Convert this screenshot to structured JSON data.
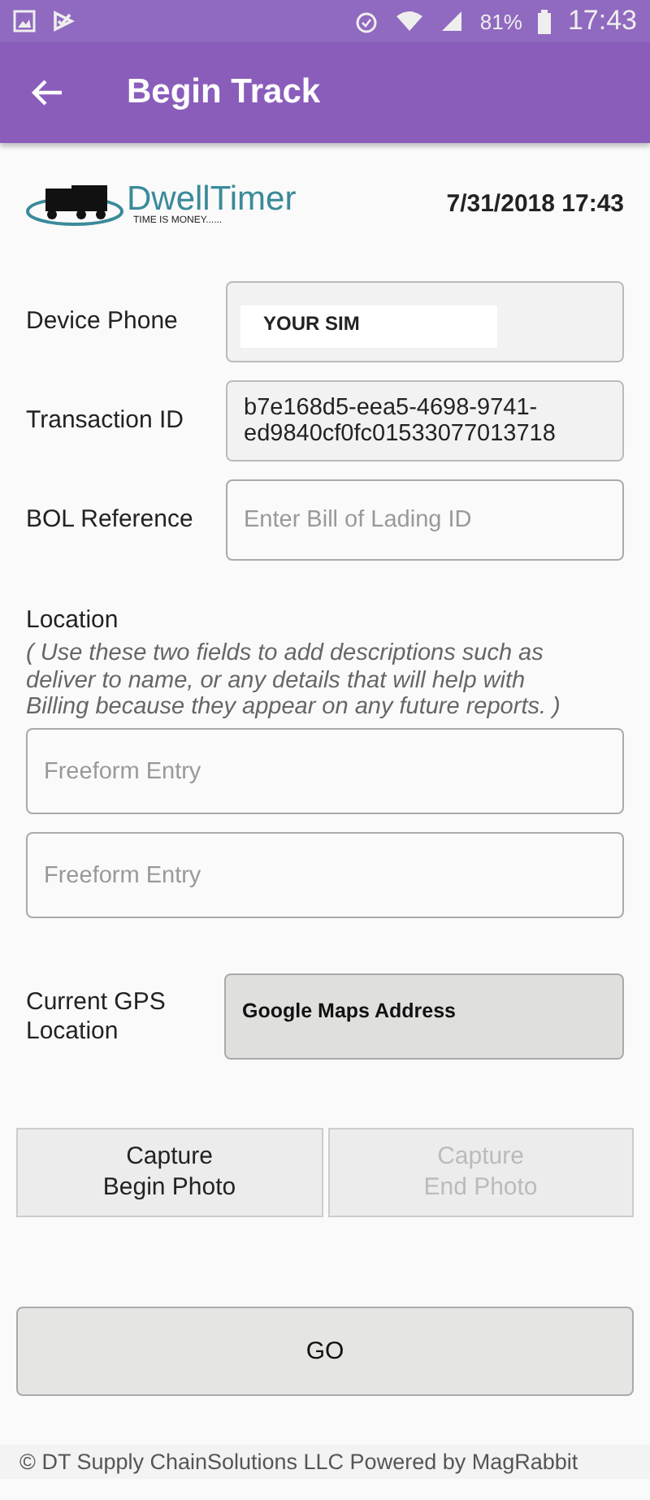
{
  "status_bar": {
    "battery": "81%",
    "time": "17:43"
  },
  "app_bar": {
    "title": "Begin Track"
  },
  "header": {
    "brand": "DwellTimer",
    "tagline": "TIME IS MONEY......",
    "datetime": "7/31/2018 17:43"
  },
  "fields": [
    {
      "label": "Device Phone",
      "kind": "sim",
      "value": "YOUR SIM"
    },
    {
      "label": "Transaction ID",
      "kind": "readonly",
      "value": "b7e168d5-eea5-4698-9741-ed9840cf0fc01533077013718"
    },
    {
      "label": "BOL Reference",
      "kind": "input",
      "placeholder": "Enter Bill of Lading ID"
    }
  ],
  "location": {
    "label": "Location",
    "note": "( Use these two fields to add descriptions such as deliver to name, or any details that will help with Billing because they appear on any future reports. )",
    "inputs": [
      {
        "placeholder": "Freeform Entry"
      },
      {
        "placeholder": "Freeform Entry"
      }
    ]
  },
  "gps": {
    "label": "Current GPS Location",
    "value": "Google Maps Address"
  },
  "photo_buttons": [
    {
      "label": "Capture\nBegin Photo",
      "disabled": false
    },
    {
      "label": "Capture\nEnd Photo",
      "disabled": true
    }
  ],
  "go_button": "GO",
  "footer": "© DT Supply ChainSolutions LLC  Powered by MagRabbit"
}
